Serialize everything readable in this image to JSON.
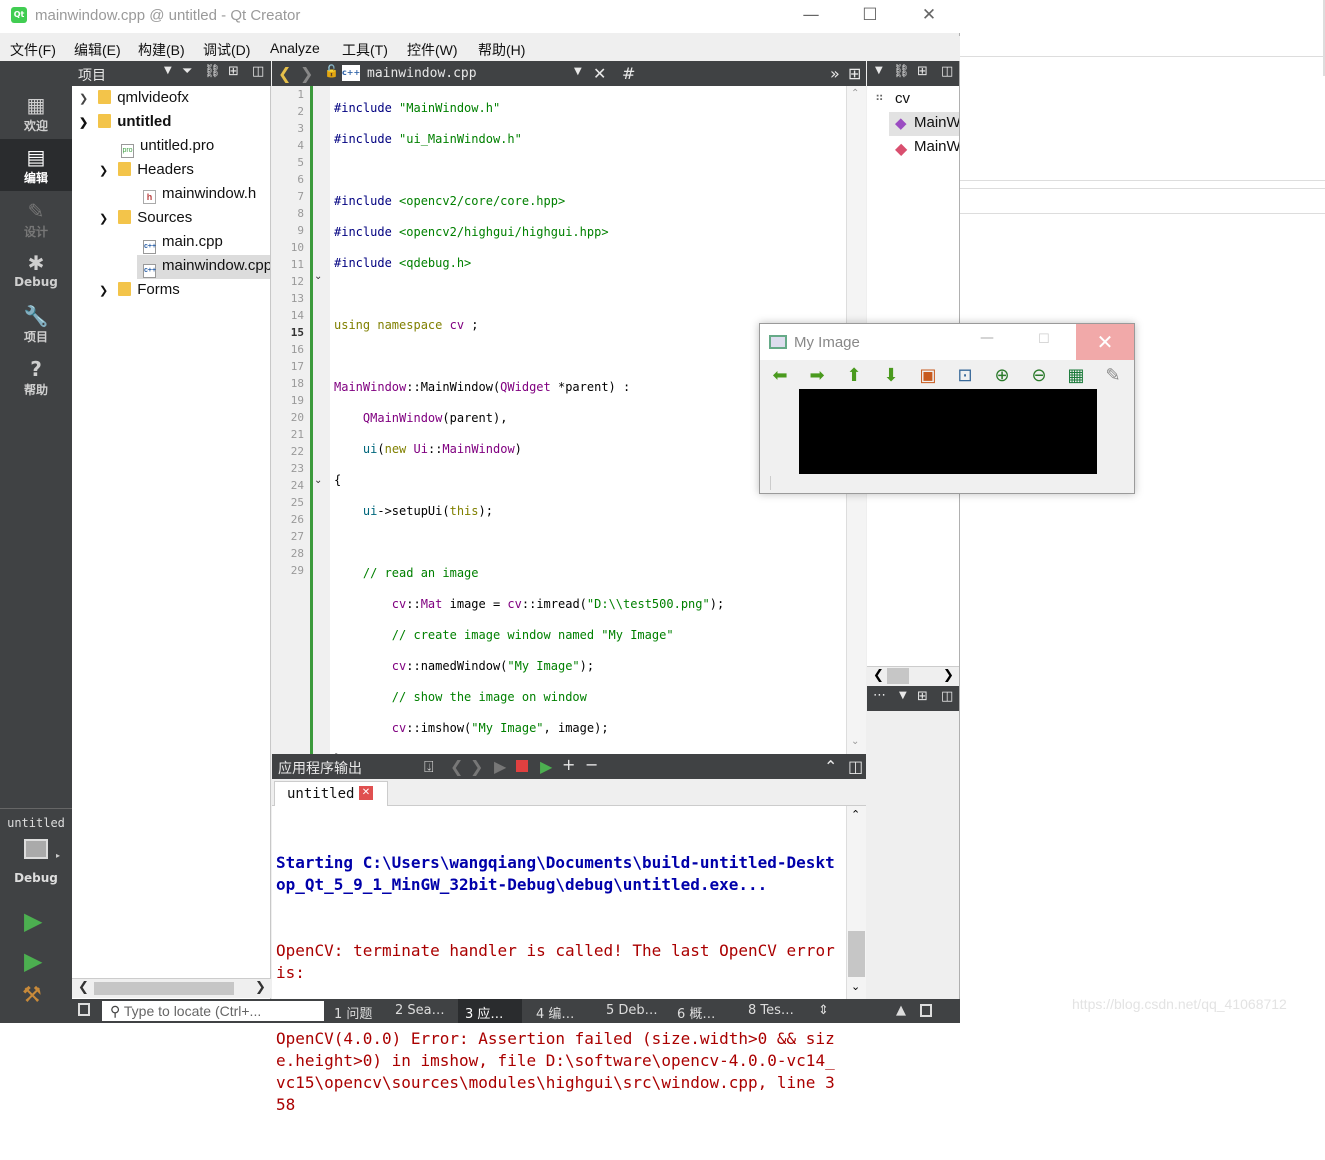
{
  "window": {
    "title": "mainwindow.cpp @ untitled - Qt Creator",
    "app_icon": "Qt",
    "minimize": "—",
    "maximize": "☐",
    "close": "✕"
  },
  "menu": [
    "文件(F)",
    "编辑(E)",
    "构建(B)",
    "调试(D)",
    "Analyze",
    "工具(T)",
    "控件(W)",
    "帮助(H)"
  ],
  "modes": [
    {
      "label": "欢迎",
      "icon": "▦",
      "icon_name": "grid-icon"
    },
    {
      "label": "编辑",
      "icon": "▤",
      "icon_name": "edit-icon"
    },
    {
      "label": "设计",
      "icon": "✎",
      "icon_name": "pencil-icon"
    },
    {
      "label": "Debug",
      "icon": "✱",
      "icon_name": "bug-icon"
    },
    {
      "label": "项目",
      "icon": "🔧",
      "icon_name": "wrench-icon"
    },
    {
      "label": "帮助",
      "icon": "?",
      "icon_name": "help-icon"
    }
  ],
  "kit": {
    "project": "untitled",
    "mode": "Debug"
  },
  "project_pane": {
    "title": "项目",
    "tree": [
      {
        "label": "qmlvideofx",
        "bold": false
      },
      {
        "label": "untitled",
        "bold": true
      },
      {
        "label": "untitled.pro",
        "bold": false
      },
      {
        "label": "Headers",
        "bold": false
      },
      {
        "label": "mainwindow.h",
        "bold": false
      },
      {
        "label": "Sources",
        "bold": false
      },
      {
        "label": "main.cpp",
        "bold": false
      },
      {
        "label": "mainwindow.cpp",
        "bold": false
      },
      {
        "label": "Forms",
        "bold": false
      }
    ]
  },
  "editor": {
    "file": "mainwindow.cpp",
    "symbol": "#",
    "line_count": 29
  },
  "outline": {
    "items": [
      "cv",
      "MainWindow",
      "MainWindow"
    ]
  },
  "output": {
    "title": "应用程序输出",
    "tab": "untitled",
    "lines": [
      {
        "text": "Starting C:\\Users\\wangqiang\\Documents\\build-untitled-Desktop_Qt_5_9_1_MinGW_32bit-Debug\\debug\\untitled.exe...",
        "style": "bl"
      },
      {
        "text": "OpenCV: terminate handler is called! The last OpenCV error is:",
        "style": "err"
      },
      {
        "text": "OpenCV(4.0.0) Error: Assertion failed (size.width>0 && size.height>0) in imshow, file D:\\software\\opencv-4.0.0-vc14_vc15\\opencv\\sources\\modules\\highgui\\src\\window.cpp, line 358",
        "style": "err"
      }
    ]
  },
  "statusbar": {
    "locator_placeholder": "Type to locate (Ctrl+...",
    "tabs": [
      "1 问题",
      "2 Sea…",
      "3 应…",
      "4 编…",
      "5 Deb…",
      "6 概…",
      "8 Tes…"
    ]
  },
  "image_window": {
    "title": "My Image"
  },
  "watermark": "https://blog.csdn.net/qq_41068712"
}
